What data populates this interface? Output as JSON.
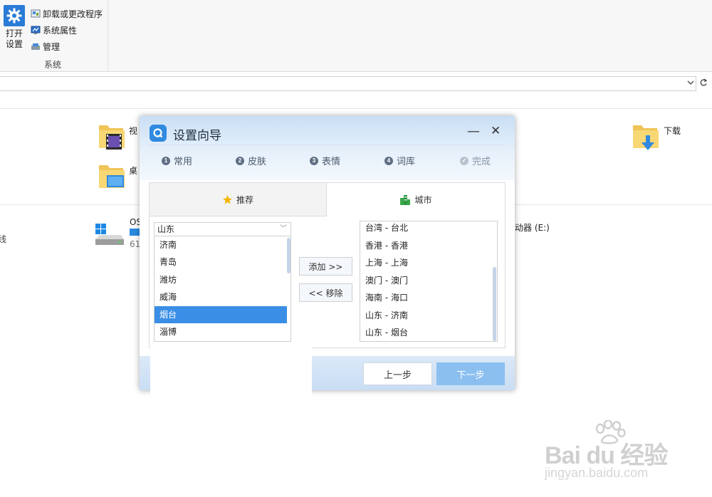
{
  "ribbon": {
    "open_settings_label": "打开\n设置",
    "items": [
      {
        "label": "卸载或更改程序",
        "icon": "programs-icon"
      },
      {
        "label": "系统属性",
        "icon": "system-properties-icon"
      },
      {
        "label": "管理",
        "icon": "manage-icon"
      }
    ],
    "group_label": "系统"
  },
  "explorer": {
    "folders": [
      {
        "label": "视",
        "icon": "videos-folder-icon"
      },
      {
        "label": "桌",
        "icon": "desktop-folder-icon"
      },
      {
        "label": "下载",
        "icon": "downloads-folder-icon"
      }
    ],
    "left_edge_text": "线",
    "drive_c_label": "OS",
    "drive_c_sub": "61",
    "drive_e_label": "动器 (E:)"
  },
  "dialog": {
    "title": "设置向导",
    "steps": [
      {
        "num": "1",
        "label": "常用"
      },
      {
        "num": "2",
        "label": "皮肤"
      },
      {
        "num": "3",
        "label": "表情"
      },
      {
        "num": "4",
        "label": "词库"
      },
      {
        "num": "✓",
        "label": "完成"
      }
    ],
    "tabs": {
      "recommend": "推荐",
      "city": "城市"
    },
    "province_select": "山东",
    "left_list": [
      "济南",
      "青岛",
      "潍坊",
      "威海",
      "烟台",
      "淄博"
    ],
    "selected_left": "烟台",
    "right_list": [
      "台湾 - 台北",
      "香港 - 香港",
      "上海 - 上海",
      "澳门 - 澳门",
      "海南 - 海口",
      "山东 - 济南",
      "山东 - 烟台"
    ],
    "add_button": "添加 >>",
    "remove_button": "<< 移除",
    "prev_button": "上一步",
    "next_button": "下一步"
  },
  "colors": {
    "accent": "#3a8ee6",
    "next_button": "#8bbff0",
    "header_gradient_top": "#c9dff5"
  },
  "watermark": {
    "brand": "Bai du 经验",
    "url": "jingyan.baidu.com"
  }
}
